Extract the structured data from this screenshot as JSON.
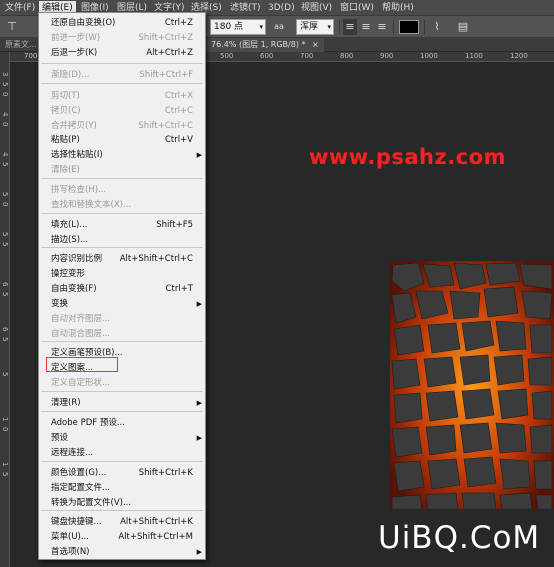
{
  "menubar": {
    "items": [
      "文件(F)",
      "编辑(E)",
      "图像(I)",
      "图层(L)",
      "文字(Y)",
      "选择(S)",
      "滤镜(T)",
      "3D(D)",
      "视图(V)",
      "窗口(W)",
      "帮助(H)"
    ]
  },
  "options": {
    "font_size": "180 点",
    "aa_icon": "aa",
    "aa_mode": "浑厚"
  },
  "tabs": {
    "left": "原素文...",
    "active": "76.4% (图层 1, RGB/8) *"
  },
  "ruler": {
    "h_ticks": [
      "700",
      "500",
      "600",
      "700",
      "800",
      "900",
      "1000",
      "1100",
      "1200"
    ],
    "v_ticks": [
      "3",
      "5",
      "0",
      "4",
      "0",
      "4",
      "5",
      "5",
      "0",
      "5",
      "5",
      "6",
      "5",
      "6",
      "5",
      "5",
      "1",
      "0",
      "1",
      "5"
    ]
  },
  "canvas": {
    "watermark_top": "www.psahz.com",
    "watermark_bottom": "UiBQ.CoM"
  },
  "edit_menu": {
    "rows": [
      {
        "label": "还原自由变换(O)",
        "shortcut": "Ctrl+Z",
        "disabled": false,
        "submenu": false
      },
      {
        "label": "前进一步(W)",
        "shortcut": "Shift+Ctrl+Z",
        "disabled": true,
        "submenu": false
      },
      {
        "label": "后退一步(K)",
        "shortcut": "Alt+Ctrl+Z",
        "disabled": false,
        "submenu": false
      },
      {
        "label": "渐隐(D)...",
        "shortcut": "Shift+Ctrl+F",
        "disabled": true,
        "submenu": false
      },
      {
        "label": "剪切(T)",
        "shortcut": "Ctrl+X",
        "disabled": true,
        "submenu": false
      },
      {
        "label": "拷贝(C)",
        "shortcut": "Ctrl+C",
        "disabled": true,
        "submenu": false
      },
      {
        "label": "合并拷贝(Y)",
        "shortcut": "Shift+Ctrl+C",
        "disabled": true,
        "submenu": false
      },
      {
        "label": "粘贴(P)",
        "shortcut": "Ctrl+V",
        "disabled": false,
        "submenu": false
      },
      {
        "label": "选择性粘贴(I)",
        "shortcut": "",
        "disabled": false,
        "submenu": true
      },
      {
        "label": "清除(E)",
        "shortcut": "",
        "disabled": true,
        "submenu": false
      },
      {
        "label": "拼写检查(H)...",
        "shortcut": "",
        "disabled": true,
        "submenu": false
      },
      {
        "label": "查找和替换文本(X)...",
        "shortcut": "",
        "disabled": true,
        "submenu": false
      },
      {
        "label": "填充(L)...",
        "shortcut": "Shift+F5",
        "disabled": false,
        "submenu": false
      },
      {
        "label": "描边(S)...",
        "shortcut": "",
        "disabled": false,
        "submenu": false
      },
      {
        "label": "内容识别比例",
        "shortcut": "Alt+Shift+Ctrl+C",
        "disabled": false,
        "submenu": false
      },
      {
        "label": "操控变形",
        "shortcut": "",
        "disabled": false,
        "submenu": false
      },
      {
        "label": "自由变换(F)",
        "shortcut": "Ctrl+T",
        "disabled": false,
        "submenu": false
      },
      {
        "label": "变换",
        "shortcut": "",
        "disabled": false,
        "submenu": true
      },
      {
        "label": "自动对齐图层...",
        "shortcut": "",
        "disabled": true,
        "submenu": false
      },
      {
        "label": "自动混合图层...",
        "shortcut": "",
        "disabled": true,
        "submenu": false
      },
      {
        "label": "定义画笔预设(B)...",
        "shortcut": "",
        "disabled": false,
        "submenu": false
      },
      {
        "label": "定义图案...",
        "shortcut": "",
        "disabled": false,
        "submenu": false
      },
      {
        "label": "定义自定形状...",
        "shortcut": "",
        "disabled": true,
        "submenu": false
      },
      {
        "label": "清理(R)",
        "shortcut": "",
        "disabled": false,
        "submenu": true
      },
      {
        "label": "Adobe PDF 预设...",
        "shortcut": "",
        "disabled": false,
        "submenu": false
      },
      {
        "label": "预设",
        "shortcut": "",
        "disabled": false,
        "submenu": true
      },
      {
        "label": "远程连接...",
        "shortcut": "",
        "disabled": false,
        "submenu": false
      },
      {
        "label": "颜色设置(G)...",
        "shortcut": "Shift+Ctrl+K",
        "disabled": false,
        "submenu": false
      },
      {
        "label": "指定配置文件...",
        "shortcut": "",
        "disabled": false,
        "submenu": false
      },
      {
        "label": "转换为配置文件(V)...",
        "shortcut": "",
        "disabled": false,
        "submenu": false
      },
      {
        "label": "键盘快捷键...",
        "shortcut": "Alt+Shift+Ctrl+K",
        "disabled": false,
        "submenu": false
      },
      {
        "label": "菜单(U)...",
        "shortcut": "Alt+Shift+Ctrl+M",
        "disabled": false,
        "submenu": false
      },
      {
        "label": "首选项(N)",
        "shortcut": "",
        "disabled": false,
        "submenu": true
      }
    ]
  },
  "colors": {
    "highlight": "#e53935",
    "watermark": "#ff2020"
  }
}
